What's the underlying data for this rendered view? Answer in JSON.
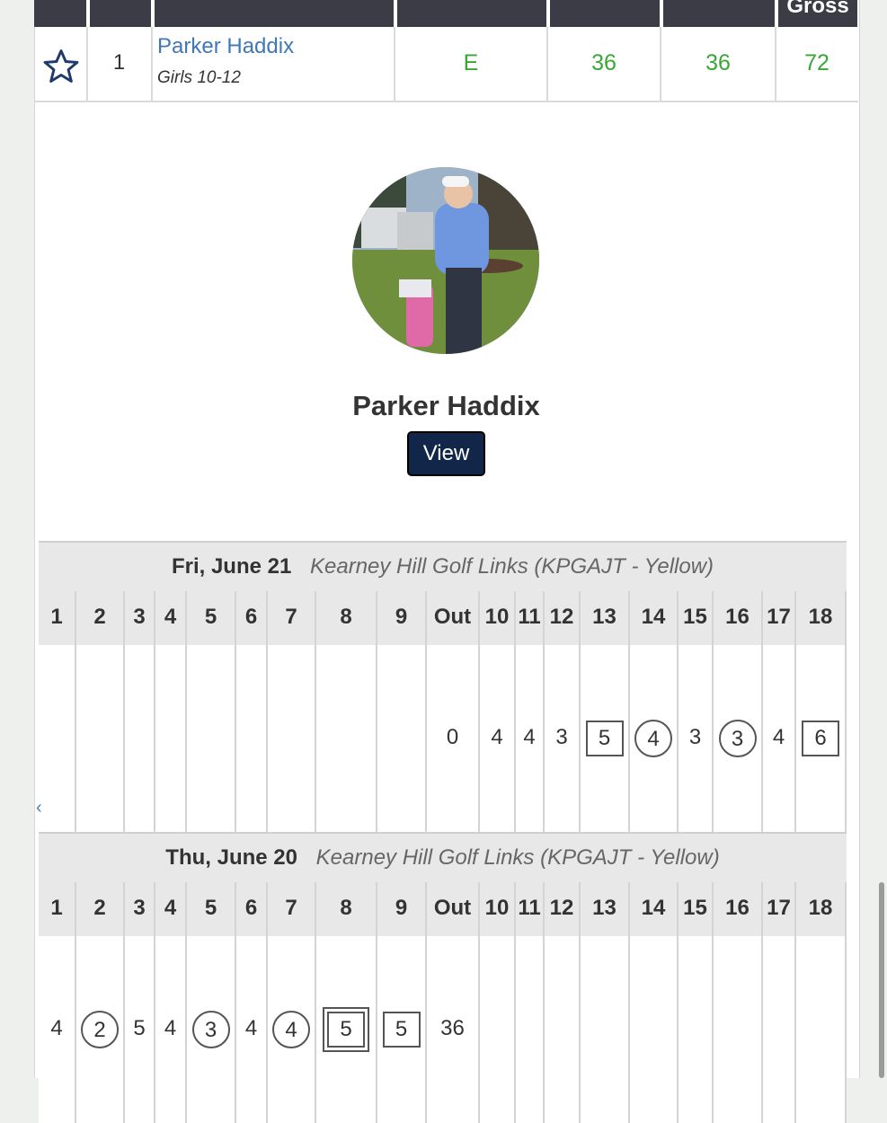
{
  "leaderboard": {
    "header_partial_label": "Gross",
    "row": {
      "position": "1",
      "name": "Parker Haddix",
      "division": "Girls 10-12",
      "to_par": "E",
      "r1": "36",
      "r2": "36",
      "gross": "72",
      "score_color": "#3aa635"
    }
  },
  "profile": {
    "name": "Parker Haddix",
    "view_button": "View"
  },
  "rounds": [
    {
      "date": "Fri, June 21",
      "course": "Kearney Hill Golf Links (KPGAJT - Yellow)",
      "holes": [
        "1",
        "2",
        "3",
        "4",
        "5",
        "6",
        "7",
        "8",
        "9",
        "Out",
        "10",
        "11",
        "12",
        "13",
        "14",
        "15",
        "16",
        "17",
        "18"
      ],
      "scores": [
        {
          "v": "",
          "m": ""
        },
        {
          "v": "",
          "m": ""
        },
        {
          "v": "",
          "m": ""
        },
        {
          "v": "",
          "m": ""
        },
        {
          "v": "",
          "m": ""
        },
        {
          "v": "",
          "m": ""
        },
        {
          "v": "",
          "m": ""
        },
        {
          "v": "",
          "m": ""
        },
        {
          "v": "",
          "m": ""
        },
        {
          "v": "0",
          "m": ""
        },
        {
          "v": "4",
          "m": ""
        },
        {
          "v": "4",
          "m": ""
        },
        {
          "v": "3",
          "m": ""
        },
        {
          "v": "5",
          "m": "square"
        },
        {
          "v": "4",
          "m": "circle"
        },
        {
          "v": "3",
          "m": ""
        },
        {
          "v": "3",
          "m": "circle"
        },
        {
          "v": "4",
          "m": ""
        },
        {
          "v": "6",
          "m": "square"
        }
      ]
    },
    {
      "date": "Thu, June 20",
      "course": "Kearney Hill Golf Links (KPGAJT - Yellow)",
      "holes": [
        "1",
        "2",
        "3",
        "4",
        "5",
        "6",
        "7",
        "8",
        "9",
        "Out",
        "10",
        "11",
        "12",
        "13",
        "14",
        "15",
        "16",
        "17",
        "18"
      ],
      "scores": [
        {
          "v": "4",
          "m": ""
        },
        {
          "v": "2",
          "m": "circle"
        },
        {
          "v": "5",
          "m": ""
        },
        {
          "v": "4",
          "m": ""
        },
        {
          "v": "3",
          "m": "circle"
        },
        {
          "v": "4",
          "m": ""
        },
        {
          "v": "4",
          "m": "circle"
        },
        {
          "v": "5",
          "m": "dsquare"
        },
        {
          "v": "5",
          "m": "square"
        },
        {
          "v": "36",
          "m": ""
        },
        {
          "v": "",
          "m": ""
        },
        {
          "v": "",
          "m": ""
        },
        {
          "v": "",
          "m": ""
        },
        {
          "v": "",
          "m": ""
        },
        {
          "v": "",
          "m": ""
        },
        {
          "v": "",
          "m": ""
        },
        {
          "v": "",
          "m": ""
        },
        {
          "v": "",
          "m": ""
        },
        {
          "v": "",
          "m": ""
        }
      ]
    }
  ],
  "scroll_hint": "‹"
}
